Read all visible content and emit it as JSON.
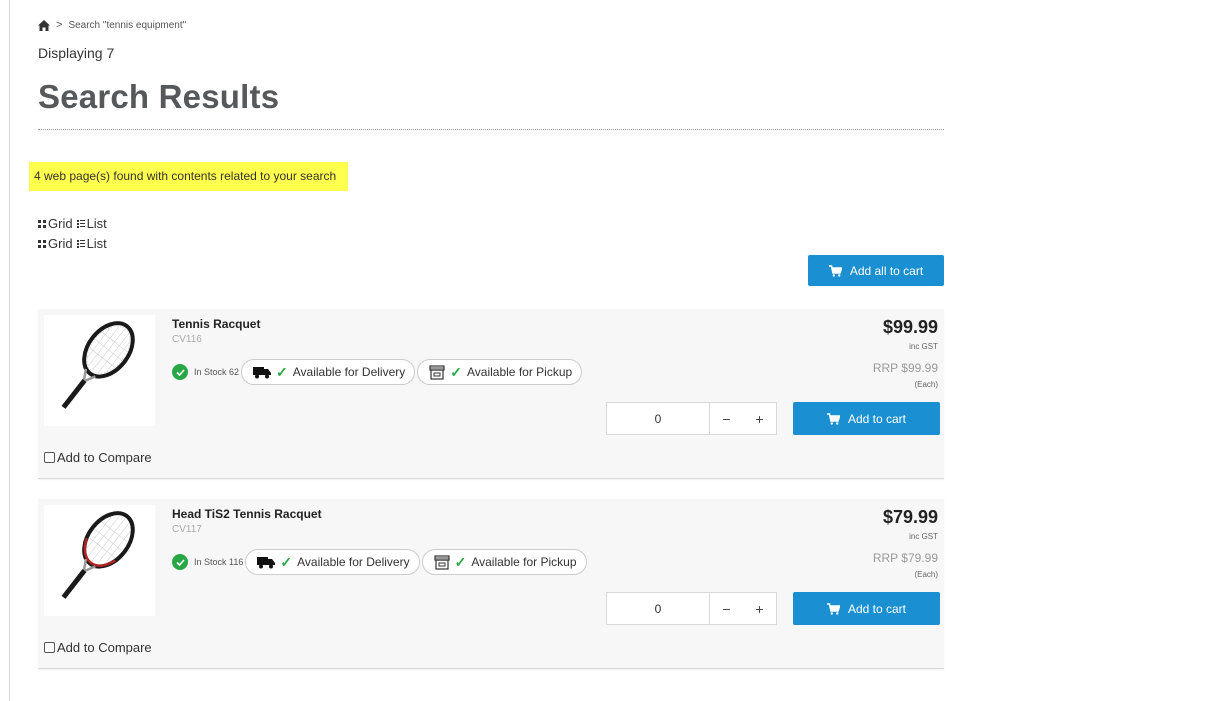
{
  "breadcrumb": {
    "home_icon": "home-icon",
    "separator": ">",
    "current": "Search \"tennis equipment\""
  },
  "displaying": "Displaying 7",
  "page_title": "Search Results",
  "notice": "4 web page(s) found with contents related to your search",
  "view_toggles": [
    {
      "grid_label": "Grid",
      "list_label": "List"
    },
    {
      "grid_label": "Grid",
      "list_label": "List"
    }
  ],
  "add_all_label": "Add all to cart",
  "colors": {
    "accent": "#1a8fd1",
    "highlight": "#ffff4d",
    "in_stock": "#28a745"
  },
  "products": [
    {
      "name": "Tennis Racquet",
      "sku": "CV116",
      "stock": "In Stock 62",
      "delivery": "Available for Delivery",
      "pickup": "Available for Pickup",
      "price": "$99.99",
      "tax_note": "inc GST",
      "rrp": "RRP $99.99",
      "unit": "(Each)",
      "qty": "0",
      "minus": "−",
      "plus": "+",
      "add_label": "Add to cart",
      "compare_label": "Add to Compare"
    },
    {
      "name": "Head TiS2 Tennis Racquet",
      "sku": "CV117",
      "stock": "In Stock 116",
      "delivery": "Available for Delivery",
      "pickup": "Available for Pickup",
      "price": "$79.99",
      "tax_note": "inc GST",
      "rrp": "RRP $79.99",
      "unit": "(Each)",
      "qty": "0",
      "minus": "−",
      "plus": "+",
      "add_label": "Add to cart",
      "compare_label": "Add to Compare"
    }
  ]
}
